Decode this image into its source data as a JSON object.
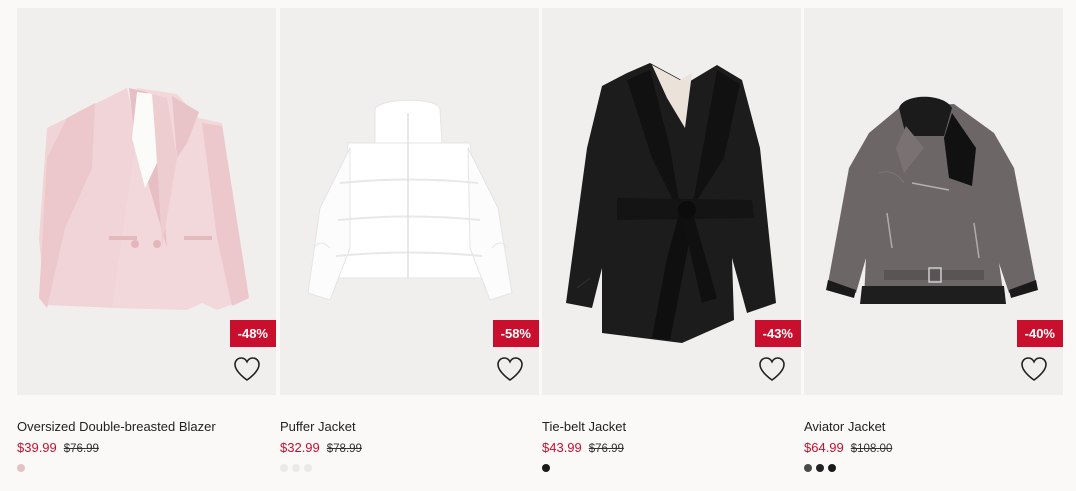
{
  "products": [
    {
      "title": "Oversized Double-breasted Blazer",
      "price": "$39.99",
      "original_price": "$76.99",
      "discount": "-48%",
      "image_icon": "pink-blazer-image",
      "favorite_icon": "heart-outline-icon",
      "swatch_colors": [
        "#e4c2c6"
      ]
    },
    {
      "title": "Puffer Jacket",
      "price": "$32.99",
      "original_price": "$78.99",
      "discount": "-58%",
      "image_icon": "white-puffer-jacket-image",
      "favorite_icon": "heart-outline-icon",
      "swatch_colors": [
        "#ece9e6",
        "#ece9e6",
        "#ece9e6"
      ]
    },
    {
      "title": "Tie-belt Jacket",
      "price": "$43.99",
      "original_price": "$76.99",
      "discount": "-43%",
      "image_icon": "black-tie-belt-jacket-image",
      "favorite_icon": "heart-outline-icon",
      "swatch_colors": [
        "#1a1a1a"
      ]
    },
    {
      "title": "Aviator Jacket",
      "price": "$64.99",
      "original_price": "$108.00",
      "discount": "-40%",
      "image_icon": "grey-aviator-jacket-image",
      "favorite_icon": "heart-outline-icon",
      "swatch_colors": [
        "#4a4a4a",
        "#222222",
        "#1a1a1a"
      ]
    }
  ],
  "colors": {
    "sale_red": "#c8102e",
    "card_bg": "#f0efee",
    "page_bg": "#faf9f8"
  }
}
